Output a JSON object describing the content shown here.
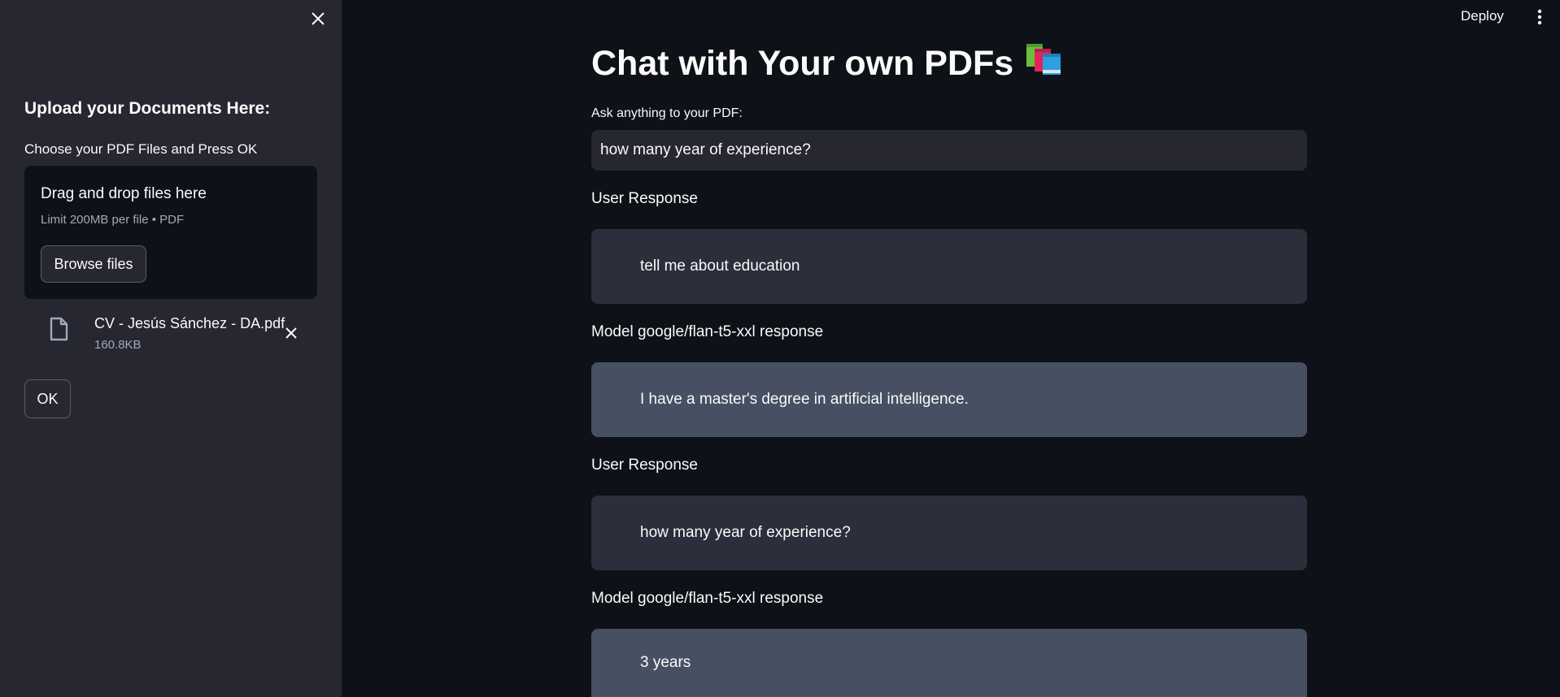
{
  "sidebar": {
    "heading": "Upload your Documents Here:",
    "uploader_label": "Choose your PDF Files and Press OK",
    "dropzone": {
      "title": "Drag and drop files here",
      "limit": "Limit 200MB per file • PDF",
      "browse_label": "Browse files"
    },
    "file": {
      "name": "CV - Jesús Sánchez - DA.pdf",
      "size": "160.8KB"
    },
    "ok_label": "OK"
  },
  "topbar": {
    "deploy_label": "Deploy"
  },
  "main": {
    "title": "Chat with Your own PDFs",
    "title_emoji": "📚",
    "ask_label": "Ask anything to your PDF:",
    "ask_value": "how many year of experience?",
    "messages": [
      {
        "label": "User Response",
        "text": "tell me about education"
      },
      {
        "label": "Model google/flan-t5-xxl response",
        "text": "I have a master's degree in artificial intelligence."
      },
      {
        "label": "User Response",
        "text": "how many year of experience?"
      },
      {
        "label": "Model google/flan-t5-xxl response",
        "text": "3 years"
      }
    ]
  },
  "colors": {
    "background": "#0e1117",
    "sidebar": "#262730",
    "user_bubble": "#2b2f3b",
    "model_bubble": "#475063",
    "text": "#fafafa"
  }
}
